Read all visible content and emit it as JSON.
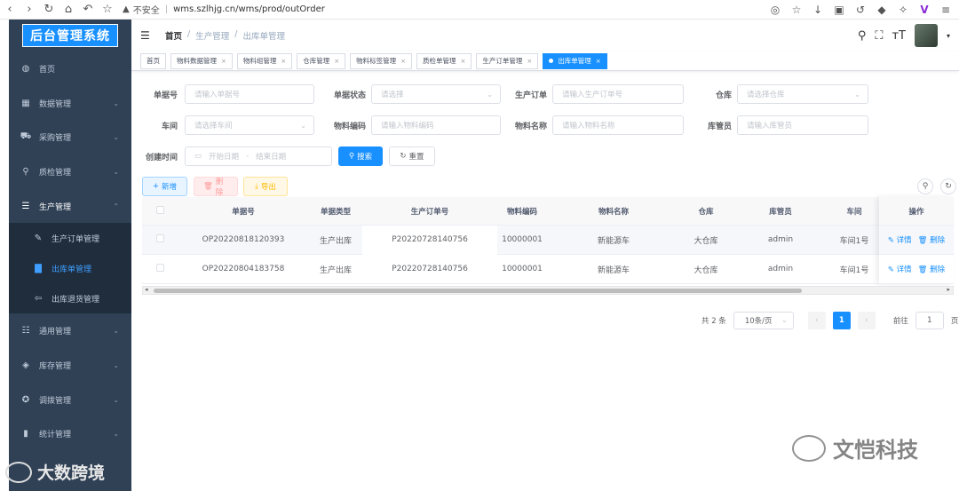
{
  "browser": {
    "insecure_label": "不安全",
    "url": "wms.szlhjg.cn/wms/prod/outOrder"
  },
  "sidebar": {
    "logo": "后台管理系统",
    "items": [
      {
        "label": "首页",
        "icon": "dashboard-icon"
      },
      {
        "label": "数据管理",
        "icon": "grid-icon"
      },
      {
        "label": "采购管理",
        "icon": "cart-icon"
      },
      {
        "label": "质检管理",
        "icon": "search-icon"
      },
      {
        "label": "生产管理",
        "icon": "list-icon"
      },
      {
        "label": "通用管理",
        "icon": "list-icon"
      },
      {
        "label": "库存管理",
        "icon": "stack-icon"
      },
      {
        "label": "调拨管理",
        "icon": "cycle-icon"
      },
      {
        "label": "统计管理",
        "icon": "chart-icon"
      }
    ],
    "submenu": [
      {
        "label": "生产订单管理",
        "icon": "edit-icon"
      },
      {
        "label": "出库单管理",
        "icon": "document-icon"
      },
      {
        "label": "出库退货管理",
        "icon": "return-icon"
      }
    ]
  },
  "header": {
    "breadcrumb": [
      "首页",
      "生产管理",
      "出库单管理"
    ]
  },
  "tags": [
    "首页",
    "物料数据管理",
    "物料组管理",
    "仓库管理",
    "物料标签管理",
    "质检单管理",
    "生产订单管理",
    "出库单管理"
  ],
  "form": {
    "order_no": {
      "label": "单据号",
      "placeholder": "请输入单据号"
    },
    "status": {
      "label": "单据状态",
      "placeholder": "请选择"
    },
    "prod_order": {
      "label": "生产订单",
      "placeholder": "请输入生产订单号"
    },
    "warehouse": {
      "label": "仓库",
      "placeholder": "请选择仓库"
    },
    "workshop": {
      "label": "车间",
      "placeholder": "请选择车间"
    },
    "material_code": {
      "label": "物料编码",
      "placeholder": "请输入物料编码"
    },
    "material_name": {
      "label": "物料名称",
      "placeholder": "请输入物料名称"
    },
    "keeper": {
      "label": "库管员",
      "placeholder": "请输入库管员"
    },
    "created": {
      "label": "创建时间",
      "start": "开始日期",
      "dash": "-",
      "end": "结束日期"
    },
    "search": "搜索",
    "reset": "重置"
  },
  "toolbar": {
    "add": "新增",
    "delete": "删除",
    "export": "导出"
  },
  "table": {
    "columns": [
      "单据号",
      "单据类型",
      "生产订单号",
      "物料编码",
      "物料名称",
      "仓库",
      "库管员",
      "车间",
      "操作"
    ],
    "rows": [
      [
        "OP20220818120393",
        "生产出库",
        "P20220728140756",
        "10000001",
        "新能源车",
        "大仓库",
        "admin",
        "车间1号"
      ],
      [
        "OP20220804183758",
        "生产出库",
        "P20220728140756",
        "10000001",
        "新能源车",
        "大仓库",
        "admin",
        "车间1号"
      ]
    ],
    "op_detail": "详情",
    "op_delete": "删除"
  },
  "pagination": {
    "total": "共 2 条",
    "page_size": "10条/页",
    "current": "1",
    "goto": "前往",
    "goto_value": "1",
    "page_suffix": "页"
  },
  "watermark": "文恺科技",
  "watermark2": "大数跨境"
}
